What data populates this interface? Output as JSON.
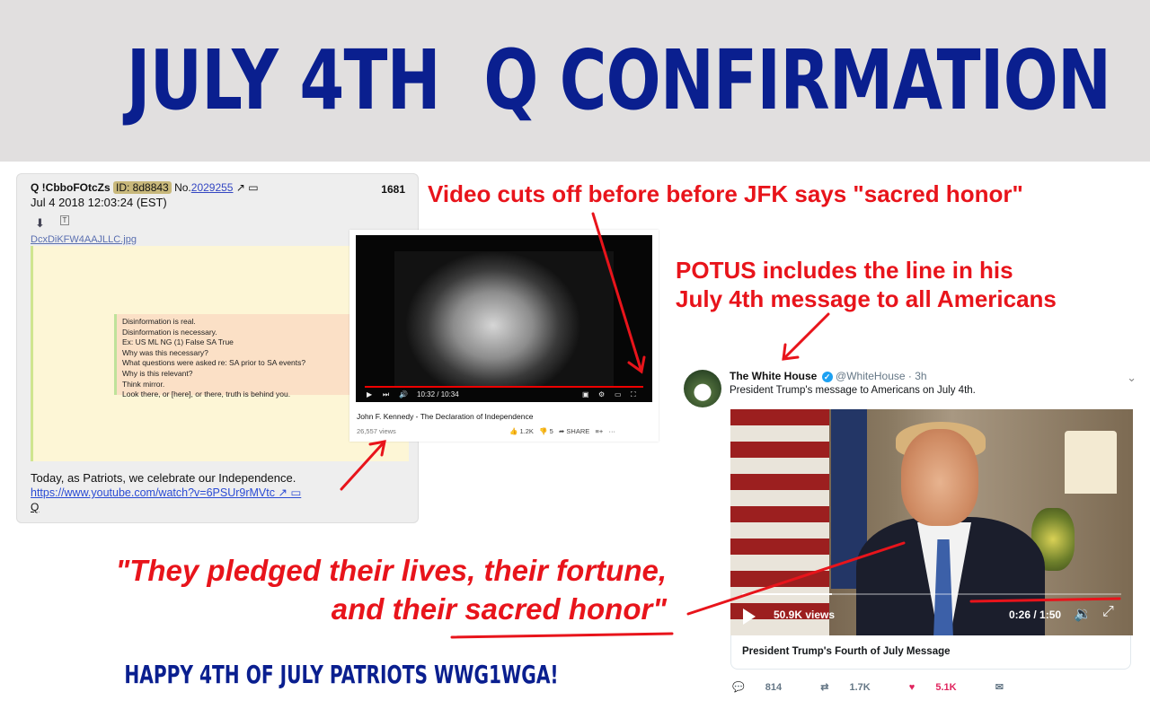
{
  "banner": {
    "title": "JULY 4TH  Q CONFIRMATION"
  },
  "qpost": {
    "author": "Q !CbboFOtcZs",
    "id": "ID: 8d8843",
    "post_no_label": "No.",
    "post_no": "2029255",
    "count": "1681",
    "date": "Jul 4 2018 12:03:24 (EST)",
    "file": "DcxDiKFW4AAJLLC.jpg",
    "lines": [
      "Disinformation is real.",
      "Disinformation is necessary.",
      "Ex: US ML NG (1) False SA True",
      "Why was this necessary?",
      "What questions were asked re: SA prior to SA events?",
      "Why is this relevant?",
      "Think mirror.",
      "Look there, or [here], or there, truth is behind you."
    ],
    "today": "Today, as Patriots, we celebrate our Independence.",
    "link": "https://www.youtube.com/watch?v=6PSUr9rMVtc",
    "signature": "Q"
  },
  "youtube": {
    "time": "10:32 / 10:34",
    "title": "John F. Kennedy - The Declaration of Independence",
    "views": "26,557 views",
    "likes": "1.2K",
    "dislikes": "5",
    "share": "SHARE"
  },
  "tweet": {
    "name": "The White House",
    "handle": "@WhiteHouse · 3h",
    "text": "President Trump's message to Americans on July 4th.",
    "views": "50.9K views",
    "time": "0:26 / 1:50",
    "caption": "President Trump's Fourth of July Message",
    "replies": "814",
    "retweets": "1.7K",
    "likes": "5.1K"
  },
  "annotations": {
    "video_cut": "Video cuts off before before JFK says \"sacred honor\"",
    "potus_line1": "POTUS includes the line in his",
    "potus_line2": "July 4th message to all Americans",
    "quote_line1": "\"They pledged their lives, their fortune,",
    "quote_line2_pre": "and their ",
    "quote_line2_u": "sacred honor",
    "quote_line2_post": "\"",
    "happy": "HAPPY 4TH OF JULY PATRIOTS WWG1WGA!"
  },
  "colors": {
    "banner_bg": "#e1dfdf",
    "title_blue": "#0a1f8f",
    "annotation_red": "#e8141b"
  }
}
